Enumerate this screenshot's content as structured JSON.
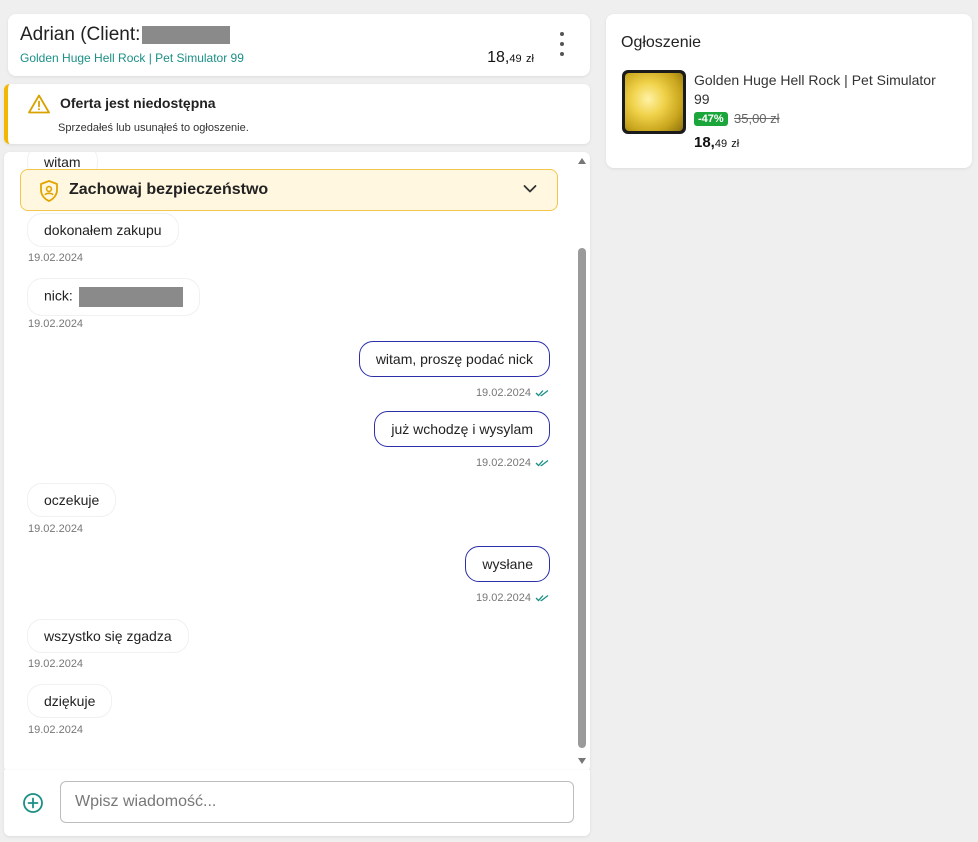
{
  "header": {
    "client_name": "Adrian (Client:",
    "product": "Golden Huge Hell Rock | Pet Simulator 99",
    "price_main": "18,",
    "price_cents": "49",
    "price_currency": "zł"
  },
  "warning": {
    "title": "Oferta jest niedostępna",
    "description": "Sprzedałeś lub usunąłeś to ogłoszenie."
  },
  "safety": {
    "label": "Zachowaj bezpieczeństwo"
  },
  "messages": [
    {
      "text": "witam"
    },
    {
      "text": "dokonałem zakupu",
      "date": "19.02.2024"
    },
    {
      "text": "nick:",
      "date": "19.02.2024"
    },
    {
      "text": "witam, proszę podać nick",
      "date": "19.02.2024"
    },
    {
      "text": "już wchodzę i wysylam",
      "date": "19.02.2024"
    },
    {
      "text": "oczekuje",
      "date": "19.02.2024"
    },
    {
      "text": "wysłane",
      "date": "19.02.2024"
    },
    {
      "text": "wszystko się zgadza",
      "date": "19.02.2024"
    },
    {
      "text": "dziękuje",
      "date": "19.02.2024"
    }
  ],
  "composer": {
    "placeholder": "Wpisz wiadomość..."
  },
  "listing": {
    "heading": "Ogłoszenie",
    "title": "Golden Huge Hell Rock | Pet Simulator 99",
    "discount": "-47%",
    "old_price": "35,00 zł",
    "new_price_main": "18,",
    "new_price_cents": "49",
    "new_price_currency": "zł"
  },
  "colors": {
    "accent_teal": "#1b8f86",
    "outgoing_border": "#2c2fa8",
    "warning_yellow": "#f2b705",
    "discount_green": "#1aa63a"
  }
}
